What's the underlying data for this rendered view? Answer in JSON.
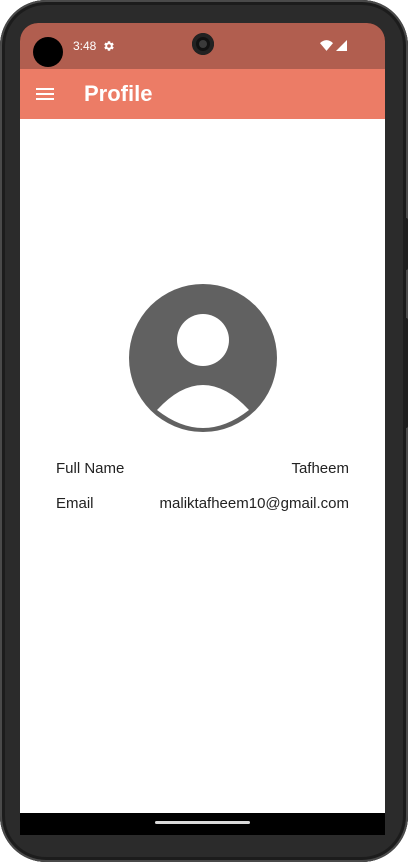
{
  "status_bar": {
    "time": "3:48",
    "color": "#b15e4f",
    "icons": [
      "settings-icon",
      "wifi-icon",
      "cellular-signal-icon"
    ]
  },
  "app_bar": {
    "title": "Profile",
    "color": "#ec7c66",
    "menu_icon": "hamburger-menu-icon"
  },
  "profile": {
    "avatar_icon": "account-circle-icon",
    "avatar_color": "#616161",
    "fields": [
      {
        "label": "Full Name",
        "value": "Tafheem"
      },
      {
        "label": "Email",
        "value": "maliktafheem10@gmail.com"
      }
    ]
  }
}
